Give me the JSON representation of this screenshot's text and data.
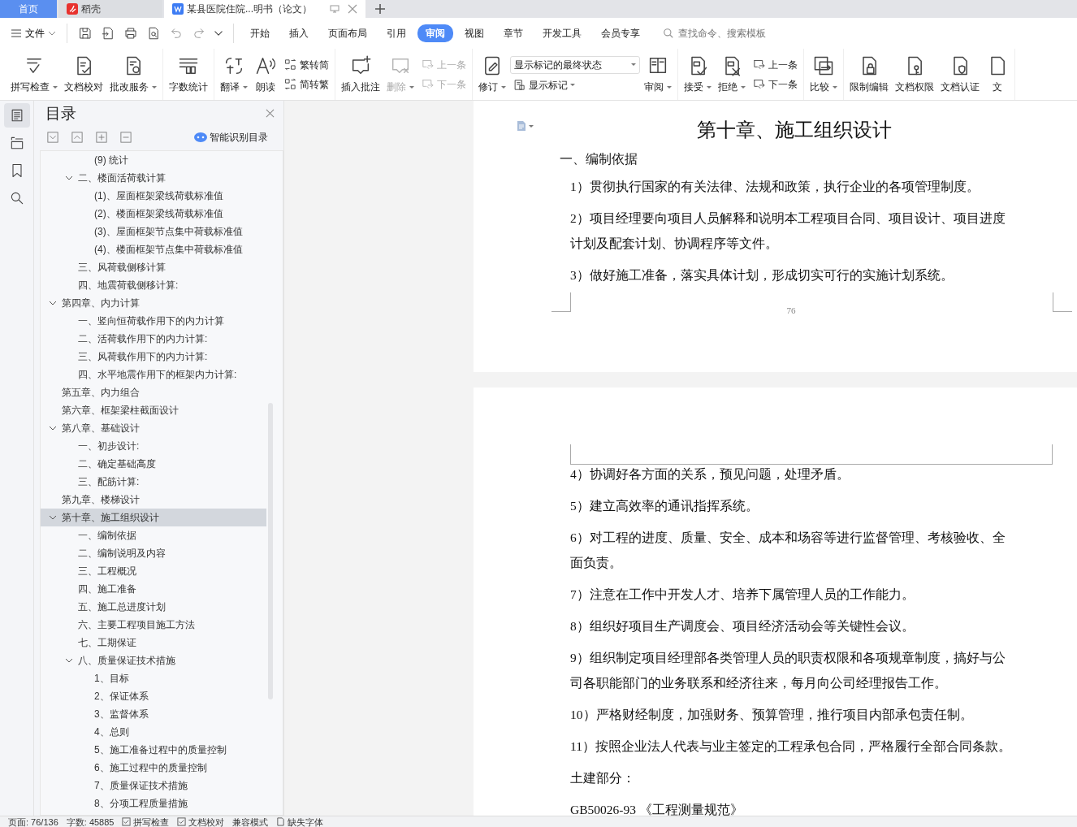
{
  "tabs": [
    {
      "label": "首页",
      "kind": "home",
      "selected": false
    },
    {
      "label": "稻壳",
      "kind": "app",
      "selected": false
    },
    {
      "label": "某县医院住院...明书（论文）",
      "kind": "doc",
      "selected": true
    }
  ],
  "file_menu": "文件",
  "ribbon_tabs": [
    {
      "label": "开始",
      "selected": false
    },
    {
      "label": "插入",
      "selected": false
    },
    {
      "label": "页面布局",
      "selected": false
    },
    {
      "label": "引用",
      "selected": false
    },
    {
      "label": "审阅",
      "selected": true
    },
    {
      "label": "视图",
      "selected": false
    },
    {
      "label": "章节",
      "selected": false
    },
    {
      "label": "开发工具",
      "selected": false
    },
    {
      "label": "会员专享",
      "selected": false
    }
  ],
  "search": {
    "placeholder": "查找命令、搜索模板"
  },
  "ribbon_groups": [
    {
      "columns": [
        [
          {
            "label": "拼写检查",
            "kind": "large",
            "dropdown": true,
            "disabled": false
          }
        ],
        [
          {
            "label": "文档校对",
            "kind": "large",
            "dropdown": false,
            "disabled": false
          }
        ],
        [
          {
            "label": "批改服务",
            "kind": "large",
            "dropdown": true,
            "disabled": false
          }
        ]
      ]
    },
    {
      "columns": [
        [
          {
            "label": "字数统计",
            "kind": "large",
            "dropdown": false,
            "disabled": false
          }
        ]
      ]
    },
    {
      "columns": [
        [
          {
            "label": "翻译",
            "kind": "large",
            "dropdown": true,
            "disabled": false
          }
        ],
        [
          {
            "label": "朗读",
            "kind": "large",
            "dropdown": false,
            "disabled": false
          }
        ],
        [
          {
            "label": "繁转简",
            "kind": "small",
            "dropdown": false,
            "disabled": false
          },
          {
            "label": "简转繁",
            "kind": "small",
            "dropdown": false,
            "disabled": false
          }
        ]
      ]
    },
    {
      "columns": [
        [
          {
            "label": "插入批注",
            "kind": "large",
            "dropdown": false,
            "disabled": false
          }
        ],
        [
          {
            "label": "删除",
            "kind": "large",
            "dropdown": true,
            "disabled": true
          }
        ],
        [
          {
            "label": "上一条",
            "kind": "small",
            "dropdown": false,
            "disabled": true
          },
          {
            "label": "下一条",
            "kind": "small",
            "dropdown": false,
            "disabled": true
          }
        ]
      ]
    },
    {
      "columns": [
        [
          {
            "label": "修订",
            "kind": "large",
            "dropdown": true,
            "disabled": false
          }
        ],
        [
          {
            "label": "显示标记的最终状态",
            "kind": "select",
            "dropdown": true,
            "disabled": false
          },
          {
            "label": "显示标记",
            "kind": "small",
            "dropdown": true,
            "disabled": false
          }
        ],
        [
          {
            "label": "审阅",
            "kind": "large",
            "dropdown": true,
            "disabled": false
          }
        ]
      ]
    },
    {
      "columns": [
        [
          {
            "label": "接受",
            "kind": "large",
            "dropdown": true,
            "disabled": false
          }
        ],
        [
          {
            "label": "拒绝",
            "kind": "large",
            "dropdown": true,
            "disabled": false
          }
        ],
        [
          {
            "label": "上一条",
            "kind": "small",
            "dropdown": false,
            "disabled": false
          },
          {
            "label": "下一条",
            "kind": "small",
            "dropdown": false,
            "disabled": false
          }
        ]
      ]
    },
    {
      "columns": [
        [
          {
            "label": "比较",
            "kind": "large",
            "dropdown": true,
            "disabled": false
          }
        ]
      ]
    },
    {
      "columns": [
        [
          {
            "label": "限制编辑",
            "kind": "large",
            "dropdown": false,
            "disabled": false
          }
        ],
        [
          {
            "label": "文档权限",
            "kind": "large",
            "dropdown": false,
            "disabled": false
          }
        ],
        [
          {
            "label": "文档认证",
            "kind": "large",
            "dropdown": false,
            "disabled": false
          }
        ],
        [
          {
            "label": "文",
            "kind": "large",
            "dropdown": false,
            "disabled": false
          }
        ]
      ]
    }
  ],
  "sidebar": {
    "title": "目录",
    "smart_toc": "智能识别目录",
    "toc": [
      {
        "children": [
          {
            "children": [
              {
                "label": "(9) 统计",
                "selected": false
              }
            ]
          },
          {
            "label": "二、楼面活荷载计算",
            "expanded": true,
            "selected": false,
            "children": [
              {
                "label": "(1)、屋面框架梁线荷载标准值",
                "selected": false
              },
              {
                "label": "(2)、楼面框架梁线荷载标准值",
                "selected": false
              },
              {
                "label": "(3)、屋面框架节点集中荷载标准值",
                "selected": false
              },
              {
                "label": "(4)、楼面框架节点集中荷载标准值",
                "selected": false
              }
            ]
          },
          {
            "label": "三、风荷载侧移计算",
            "selected": false
          },
          {
            "label": "四、地震荷载侧移计算:",
            "selected": false
          }
        ]
      },
      {
        "label": "第四章、内力计算",
        "expanded": true,
        "selected": false,
        "children": [
          {
            "label": "一、竖向恒荷载作用下的内力计算",
            "selected": false
          },
          {
            "label": "二、活荷载作用下的内力计算:",
            "selected": false
          },
          {
            "label": "三、风荷载作用下的内力计算:",
            "selected": false
          },
          {
            "label": "四、水平地震作用下的框架内力计算:",
            "selected": false
          }
        ]
      },
      {
        "label": "第五章、内力组合",
        "selected": false
      },
      {
        "label": "第六章、框架梁柱截面设计",
        "selected": false
      },
      {
        "label": "第八章、基础设计",
        "expanded": true,
        "selected": false,
        "children": [
          {
            "label": "一、初步设计:",
            "selected": false
          },
          {
            "label": "二、确定基础高度",
            "selected": false
          },
          {
            "label": "三、配筋计算:",
            "selected": false
          }
        ]
      },
      {
        "label": "第九章、楼梯设计",
        "selected": false
      },
      {
        "label": "第十章、施工组织设计",
        "expanded": true,
        "selected": true,
        "children": [
          {
            "label": "一、编制依据",
            "selected": false
          },
          {
            "label": "二、编制说明及内容",
            "selected": false
          },
          {
            "label": "三、工程概况",
            "selected": false
          },
          {
            "label": "四、施工准备",
            "selected": false
          },
          {
            "label": "五、施工总进度计划",
            "selected": false
          },
          {
            "label": "六、主要工程项目施工方法",
            "selected": false
          },
          {
            "label": "七、工期保证",
            "selected": false
          },
          {
            "label": "八、质量保证技术措施",
            "expanded": true,
            "selected": false,
            "children": [
              {
                "label": "1、目标",
                "selected": false
              },
              {
                "label": "2、保证体系",
                "selected": false
              },
              {
                "label": "3、监督体系",
                "selected": false
              },
              {
                "label": "4、总则",
                "selected": false
              },
              {
                "label": "5、施工准备过程中的质量控制",
                "selected": false
              },
              {
                "label": "6、施工过程中的质量控制",
                "selected": false
              },
              {
                "label": "7、质量保证技术措施",
                "selected": false
              },
              {
                "label": "8、分项工程质量措施",
                "selected": false
              }
            ]
          }
        ]
      }
    ]
  },
  "document": {
    "pages": [
      {
        "blocks": [
          {
            "kind": "heading",
            "text": "第十章、施工组织设计"
          },
          {
            "kind": "section",
            "text": "一、编制依据"
          },
          {
            "kind": "para",
            "text": "1）贯彻执行国家的有关法律、法规和政策，执行企业的各项管理制度。"
          },
          {
            "kind": "para",
            "text": "2）项目经理要向项目人员解释和说明本工程项目合同、项目设计、项目进度计划及配套计划、协调程序等文件。"
          },
          {
            "kind": "para",
            "text": "3）做好施工准备，落实具体计划，形成切实可行的实施计划系统。"
          }
        ],
        "page_number": "76"
      },
      {
        "blocks": [
          {
            "kind": "para",
            "text": "4）协调好各方面的关系，预见问题，处理矛盾。"
          },
          {
            "kind": "para",
            "text": "5）建立高效率的通讯指挥系统。"
          },
          {
            "kind": "para",
            "text": "6）对工程的进度、质量、安全、成本和场容等进行监督管理、考核验收、全面负责。"
          },
          {
            "kind": "para",
            "text": "7）注意在工作中开发人才、培养下属管理人员的工作能力。"
          },
          {
            "kind": "para",
            "text": "8）组织好项目生产调度会、项目经济活动会等关键性会议。"
          },
          {
            "kind": "para",
            "text": "9）组织制定项目经理部各类管理人员的职责权限和各项规章制度，搞好与公司各职能部门的业务联系和经济往来，每月向公司经理报告工作。"
          },
          {
            "kind": "para",
            "text": "10）严格财经制度，加强财务、预算管理，推行项目内部承包责任制。"
          },
          {
            "kind": "para",
            "text": "11）按照企业法人代表与业主签定的工程承包合同，严格履行全部合同条款。"
          },
          {
            "kind": "para",
            "text": "土建部分："
          },
          {
            "kind": "para",
            "text": "GB50026-93    《工程测量规范》"
          }
        ]
      }
    ]
  },
  "status_bar": [
    {
      "label": "页面: 76/136",
      "kind": "text"
    },
    {
      "label": "字数: 45885",
      "kind": "text"
    },
    {
      "label": "拼写检查",
      "kind": "check"
    },
    {
      "label": "文档校对",
      "kind": "check"
    },
    {
      "label": "兼容模式",
      "kind": "text"
    },
    {
      "label": "缺失字体",
      "kind": "doc"
    }
  ]
}
